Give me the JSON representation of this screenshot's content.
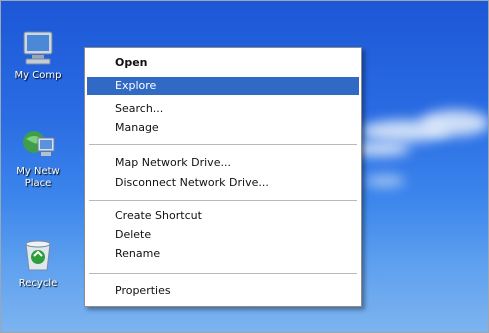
{
  "desktop": {
    "icons": [
      {
        "label": "My Comp",
        "icon": "my-computer-icon"
      },
      {
        "label": "My Netw",
        "label2": "Place",
        "icon": "network-places-icon"
      },
      {
        "label": "Recycle",
        "icon": "recycle-bin-icon"
      }
    ]
  },
  "context_menu": {
    "items": [
      {
        "label": "Open",
        "bold": true
      },
      {
        "label": "Explore",
        "highlighted": true
      },
      {
        "label": "Search..."
      },
      {
        "label": "Manage"
      },
      {
        "label": "Map Network Drive..."
      },
      {
        "label": "Disconnect Network Drive..."
      },
      {
        "label": "Create Shortcut"
      },
      {
        "label": "Delete"
      },
      {
        "label": "Rename"
      },
      {
        "label": "Properties"
      }
    ]
  },
  "colors": {
    "highlight": "#316ac5",
    "desktop_blue": "#2a6ce3"
  }
}
